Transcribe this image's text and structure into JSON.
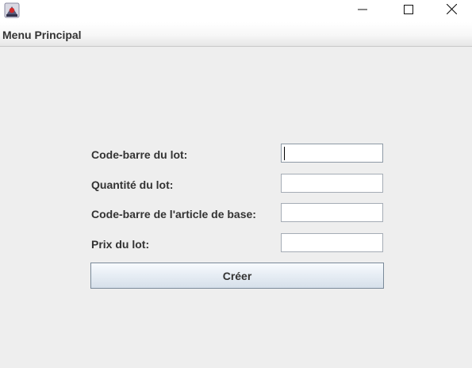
{
  "menubar": {
    "menu_principal": "Menu Principal"
  },
  "form": {
    "barcode_lot_label": "Code-barre du lot:",
    "quantity_label": "Quantité du lot:",
    "base_item_barcode_label": "Code-barre de l'article de base:",
    "price_label": "Prix du lot:",
    "barcode_lot_value": "",
    "quantity_value": "",
    "base_item_barcode_value": "",
    "price_value": "",
    "create_label": "Créer"
  },
  "icons": {
    "app": "java-app-icon",
    "minimize": "minimize-icon",
    "maximize": "maximize-icon",
    "close": "close-icon"
  },
  "colors": {
    "background": "#eeeeee",
    "text": "#333333",
    "button_gradient_top": "#f8fbfe",
    "button_gradient_bottom": "#d6e0ea",
    "button_border": "#7a8a99"
  }
}
